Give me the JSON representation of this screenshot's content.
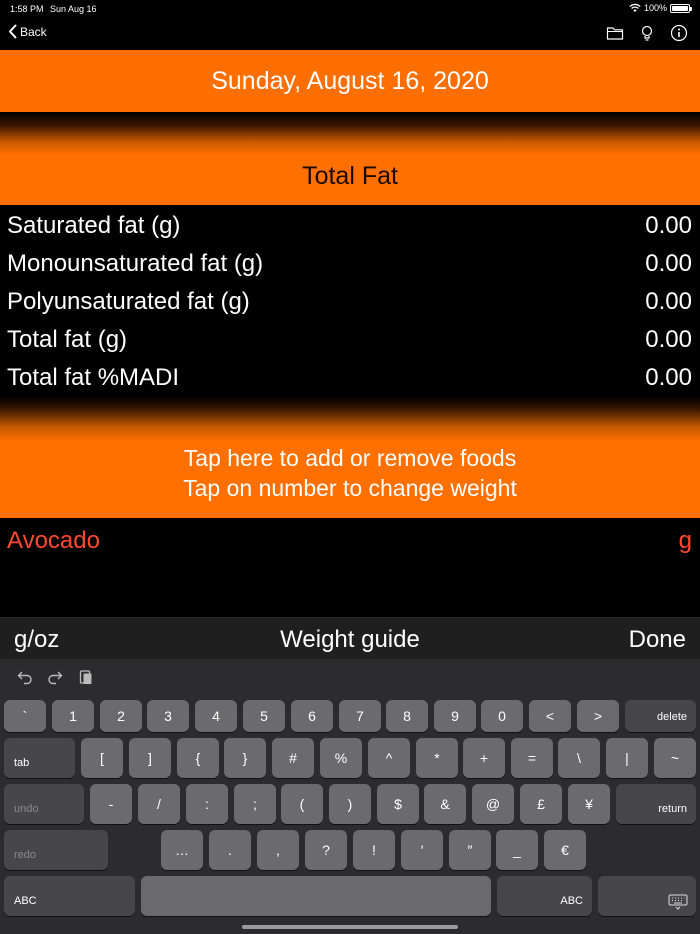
{
  "status": {
    "time": "1:58 PM",
    "date": "Sun Aug 16",
    "battery": "100%"
  },
  "nav": {
    "back_label": "Back",
    "icons": [
      "folder-icon",
      "lightbulb-icon",
      "info-icon"
    ]
  },
  "date_header": "Sunday, August 16, 2020",
  "section_title": "Total Fat",
  "nutrients": [
    {
      "label": "Saturated fat (g)",
      "value": "0.00"
    },
    {
      "label": "Monounsaturated fat (g)",
      "value": "0.00"
    },
    {
      "label": "Polyunsaturated fat (g)",
      "value": "0.00"
    },
    {
      "label": "Total fat (g)",
      "value": "0.00"
    },
    {
      "label": "Total fat %MADI",
      "value": "0.00"
    }
  ],
  "tap_hint": {
    "line1": "Tap here to add or remove foods",
    "line2": "Tap on number to change weight"
  },
  "food": {
    "name": "Avocado",
    "unit": "g"
  },
  "accessory": {
    "unit_toggle": "g/oz",
    "guide": "Weight guide",
    "done": "Done"
  },
  "keyboard": {
    "row1": [
      "`",
      "1",
      "2",
      "3",
      "4",
      "5",
      "6",
      "7",
      "8",
      "9",
      "0",
      "<",
      ">"
    ],
    "delete": "delete",
    "tab": "tab",
    "row2": [
      "[",
      "]",
      "{",
      "}",
      "#",
      "%",
      "^",
      "*",
      "+",
      "=",
      "\\",
      "|",
      "~"
    ],
    "undo": "undo",
    "row3": [
      "-",
      "/",
      ":",
      ";",
      "(",
      ")",
      "$",
      "&",
      "@",
      "£",
      "¥"
    ],
    "return": "return",
    "redo": "redo",
    "row4": [
      "…",
      ".",
      ",",
      "?",
      "!",
      "′",
      "″",
      "_",
      "€"
    ],
    "abc_left": "ABC",
    "abc_right": "ABC"
  },
  "colors": {
    "accent": "#ff6e00",
    "food_text": "#ff4a30",
    "keyboard_bg": "#2c2c2e"
  }
}
